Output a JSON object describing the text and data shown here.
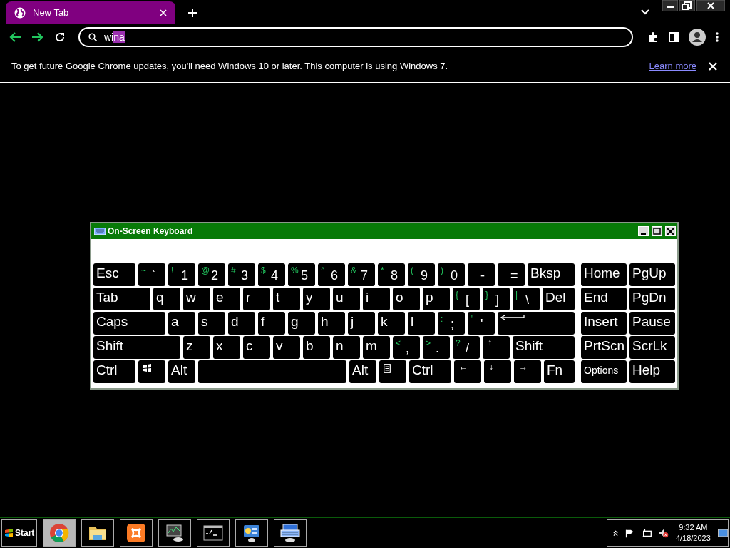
{
  "browser": {
    "tab": {
      "title": "New Tab",
      "selected": true
    },
    "address_bar": {
      "typed": "wi",
      "completion": "na"
    },
    "infobar": {
      "message": "To get future Google Chrome updates, you'll need Windows 10 or later. This computer is using Windows 7.",
      "link": "Learn more"
    }
  },
  "keyboard": {
    "title": "On-Screen Keyboard",
    "main_rows": [
      [
        {
          "label": "Esc"
        },
        {
          "shift": "~",
          "label": "`"
        },
        {
          "shift": "!",
          "label": "1"
        },
        {
          "shift": "@",
          "label": "2"
        },
        {
          "shift": "#",
          "label": "3"
        },
        {
          "shift": "$",
          "label": "4"
        },
        {
          "shift": "%",
          "label": "5"
        },
        {
          "shift": "^",
          "label": "6"
        },
        {
          "shift": "&",
          "label": "7"
        },
        {
          "shift": "*",
          "label": "8"
        },
        {
          "shift": "(",
          "label": "9"
        },
        {
          "shift": ")",
          "label": "0"
        },
        {
          "shift": "_",
          "label": "-"
        },
        {
          "shift": "+",
          "label": "="
        },
        {
          "label": "Bksp"
        }
      ],
      [
        {
          "label": "Tab"
        },
        {
          "label": "q"
        },
        {
          "label": "w"
        },
        {
          "label": "e"
        },
        {
          "label": "r"
        },
        {
          "label": "t"
        },
        {
          "label": "y"
        },
        {
          "label": "u"
        },
        {
          "label": "i"
        },
        {
          "label": "o"
        },
        {
          "label": "p"
        },
        {
          "shift": "{",
          "label": "["
        },
        {
          "shift": "}",
          "label": "]"
        },
        {
          "shift": "|",
          "label": "\\"
        },
        {
          "label": "Del"
        }
      ],
      [
        {
          "label": "Caps"
        },
        {
          "label": "a"
        },
        {
          "label": "s"
        },
        {
          "label": "d"
        },
        {
          "label": "f"
        },
        {
          "label": "g"
        },
        {
          "label": "h"
        },
        {
          "label": "j"
        },
        {
          "label": "k"
        },
        {
          "label": "l"
        },
        {
          "shift": ":",
          "label": ";"
        },
        {
          "shift": "\"",
          "label": "'"
        },
        {
          "kind": "enter"
        }
      ],
      [
        {
          "label": "Shift"
        },
        {
          "label": "z"
        },
        {
          "label": "x"
        },
        {
          "label": "c"
        },
        {
          "label": "v"
        },
        {
          "label": "b"
        },
        {
          "label": "n"
        },
        {
          "label": "m"
        },
        {
          "shift": "<",
          "label": ","
        },
        {
          "shift": ">",
          "label": "."
        },
        {
          "shift": "?",
          "label": "/"
        },
        {
          "kind": "arrow",
          "label": "↑"
        },
        {
          "label": "Shift"
        }
      ],
      [
        {
          "label": "Ctrl"
        },
        {
          "kind": "windows"
        },
        {
          "label": "Alt"
        },
        {
          "kind": "space"
        },
        {
          "label": "Alt"
        },
        {
          "kind": "menu"
        },
        {
          "label": "Ctrl"
        },
        {
          "kind": "arrow",
          "label": "←"
        },
        {
          "kind": "arrow",
          "label": "↓"
        },
        {
          "kind": "arrow",
          "label": "→"
        },
        {
          "label": "Fn"
        }
      ]
    ],
    "nav_keys": [
      {
        "label": "Home"
      },
      {
        "label": "PgUp"
      },
      {
        "label": "End"
      },
      {
        "label": "PgDn"
      },
      {
        "label": "Insert"
      },
      {
        "label": "Pause"
      },
      {
        "label": "PrtScn"
      },
      {
        "label": "ScrLk"
      },
      {
        "label": "Options"
      },
      {
        "label": "Help"
      }
    ]
  },
  "taskbar": {
    "start": "Start",
    "apps": [
      {
        "kind": "chrome",
        "selected": true
      },
      {
        "kind": "folder",
        "selected": false
      },
      {
        "kind": "xampp",
        "selected": false
      },
      {
        "kind": "monitor",
        "selected": false
      },
      {
        "kind": "terminal",
        "selected": false
      },
      {
        "kind": "control",
        "selected": false
      },
      {
        "kind": "keyboard",
        "selected": false
      }
    ],
    "time": "9:32 AM",
    "date": "4/18/2023"
  }
}
